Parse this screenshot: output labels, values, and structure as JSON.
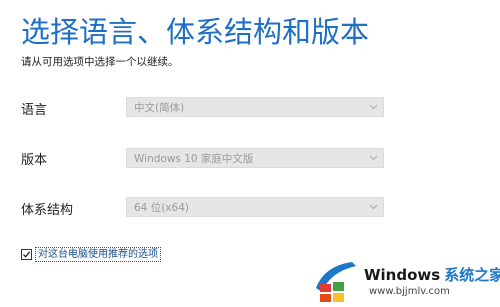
{
  "header": {
    "title": "选择语言、体系结构和版本",
    "subtitle": "请从可用选项中选择一个以继续。"
  },
  "fields": [
    {
      "label": "语言",
      "value": "中文(简体)"
    },
    {
      "label": "版本",
      "value": "Windows 10 家庭中文版"
    },
    {
      "label": "体系结构",
      "value": "64 位(x64)"
    }
  ],
  "recommend": {
    "label": "对这台电脑使用推荐的选项",
    "checked": true
  },
  "watermark": {
    "brand": "Windows",
    "brand_cn": "系统之家",
    "url": "www.bjjmlv.com"
  },
  "colors": {
    "title": "#1f6fc4",
    "disabled_select_bg": "#e6e6e6",
    "disabled_text": "#9a9a9a"
  }
}
